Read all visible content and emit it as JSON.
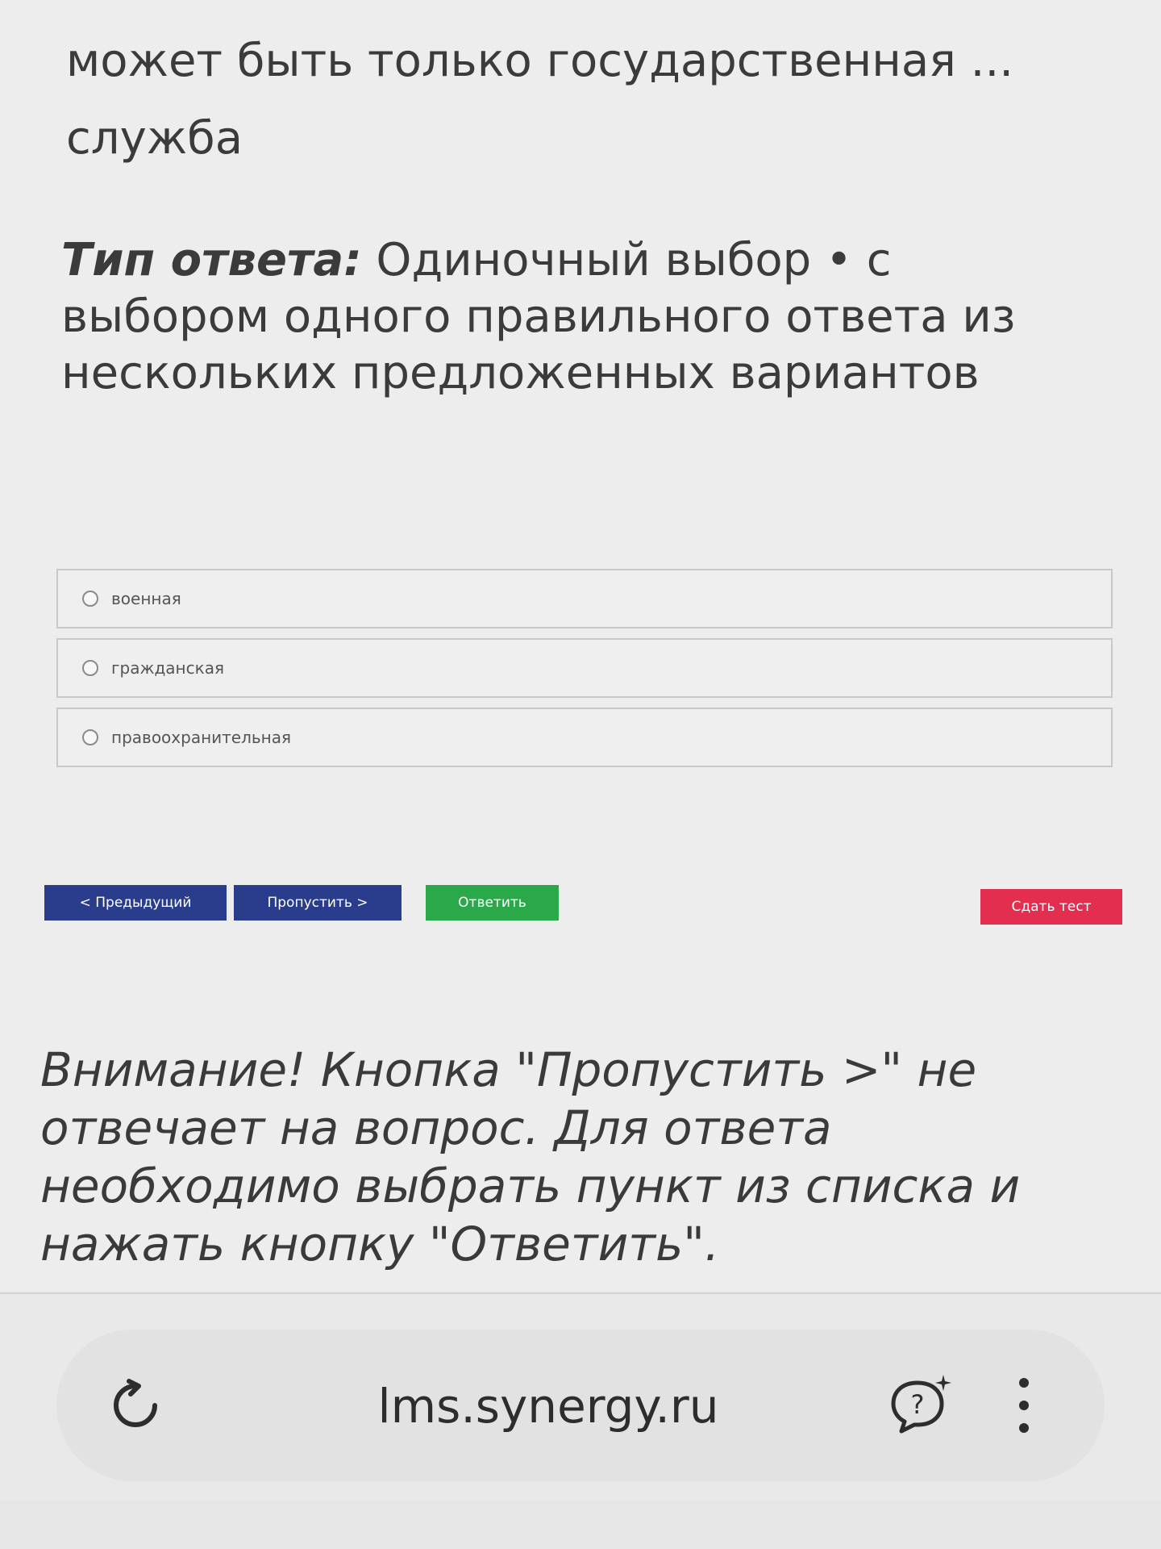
{
  "question": {
    "line1": "может быть только государственная ...",
    "line2": "служба"
  },
  "answer_type": {
    "label": "Тип ответа:",
    "text": " Одиночный выбор • с выбором одного правильного ответа из нескольких предложенных вариантов"
  },
  "options": [
    {
      "label": "военная"
    },
    {
      "label": "гражданская"
    },
    {
      "label": "правоохранительная"
    }
  ],
  "buttons": {
    "prev": "< Предыдущий",
    "skip": "Пропустить >",
    "answer": "Ответить",
    "submit": "Сдать тест"
  },
  "warning": "Внимание! Кнопка \"Пропустить >\" не отвечает на вопрос. Для ответа необходимо выбрать пункт из списка и нажать кнопку \"Ответить\".",
  "browser": {
    "url": "lms.synergy.ru",
    "icons": [
      "reload-icon",
      "help-icon",
      "menu-icon"
    ]
  },
  "colors": {
    "primary_button": "#2a3d8c",
    "answer_button": "#2aa84a",
    "submit_button": "#e32e50"
  }
}
